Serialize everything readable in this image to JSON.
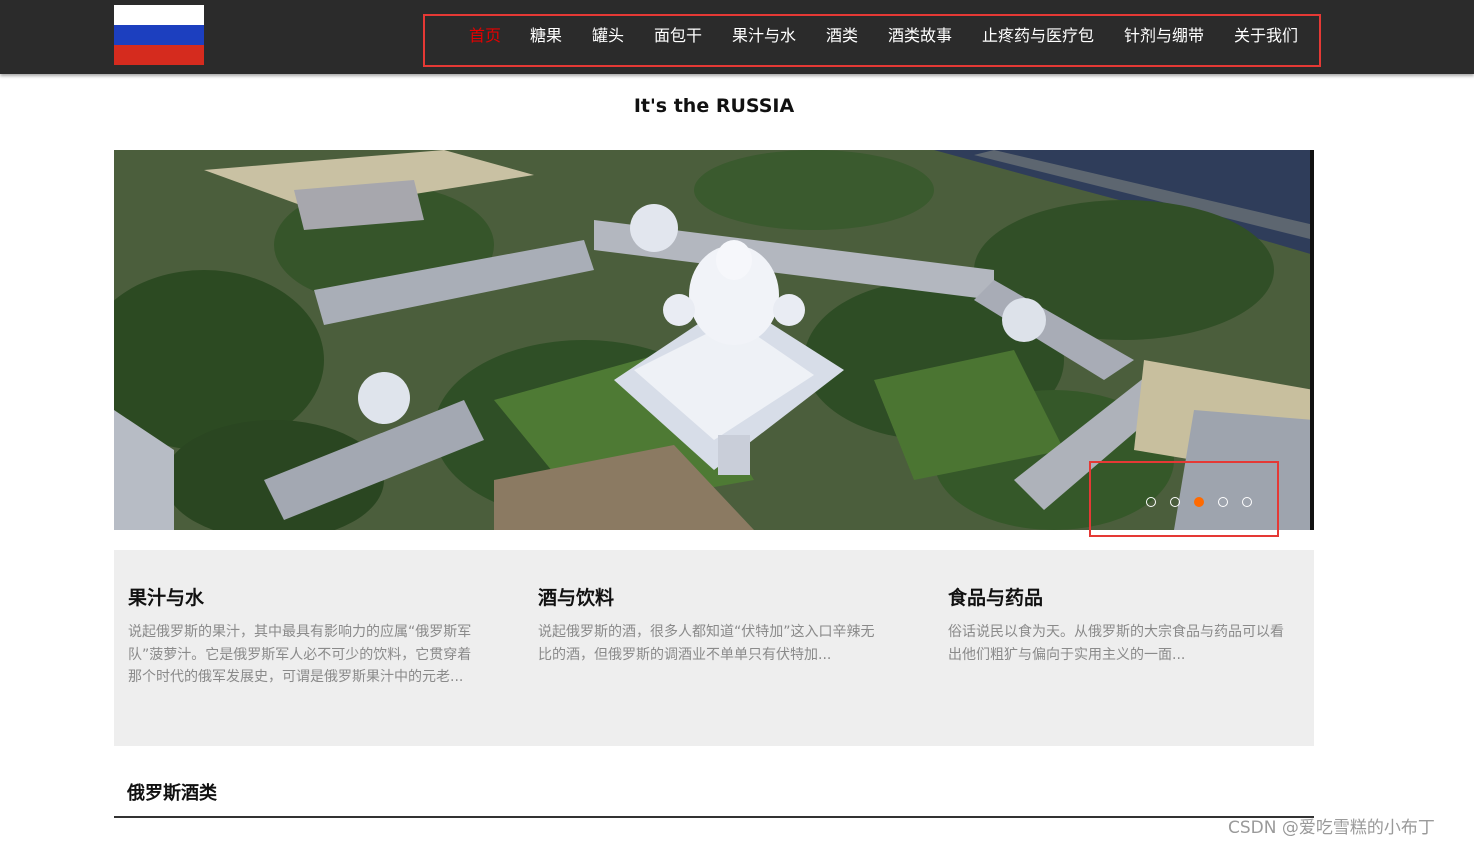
{
  "header": {
    "nav": [
      {
        "label": "首页",
        "active": true
      },
      {
        "label": "糖果",
        "active": false
      },
      {
        "label": "罐头",
        "active": false
      },
      {
        "label": "面包干",
        "active": false
      },
      {
        "label": "果汁与水",
        "active": false
      },
      {
        "label": "酒类",
        "active": false
      },
      {
        "label": "酒类故事",
        "active": false
      },
      {
        "label": "止疼药与医疗包",
        "active": false
      },
      {
        "label": "针剂与绷带",
        "active": false
      },
      {
        "label": "关于我们",
        "active": false
      }
    ],
    "highlight_color": "#e53935",
    "active_color": "#e30000"
  },
  "headline": "It's the RUSSIA",
  "carousel": {
    "slide_count": 5,
    "active_index": 2,
    "active_dot_color": "#ff6a00"
  },
  "features": [
    {
      "title": "果汁与水",
      "text": "说起俄罗斯的果汁，其中最具有影响力的应属“俄罗斯军队”菠萝汁。它是俄罗斯军人必不可少的饮料，它贯穿着那个时代的俄军发展史，可谓是俄罗斯果汁中的元老..."
    },
    {
      "title": "酒与饮料",
      "text": "说起俄罗斯的酒，很多人都知道“伏特加”这入口辛辣无比的酒，但俄罗斯的调酒业不单单只有伏特加..."
    },
    {
      "title": "食品与药品",
      "text": "俗话说民以食为天。从俄罗斯的大宗食品与药品可以看出他们粗犷与偏向于实用主义的一面..."
    }
  ],
  "section_title": "俄罗斯酒类",
  "watermark": "CSDN @爱吃雪糕的小布丁"
}
